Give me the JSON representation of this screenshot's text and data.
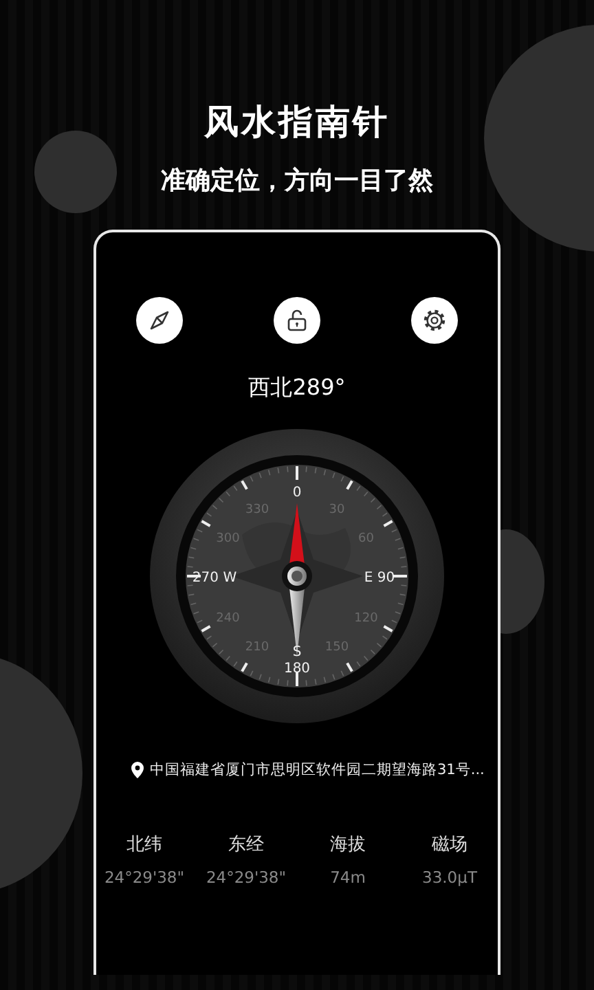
{
  "title": "风水指南针",
  "subtitle": "准确定位，方向一目了然",
  "toolbar": [
    {
      "kind": "compass"
    },
    {
      "kind": "lock"
    },
    {
      "kind": "settings"
    }
  ],
  "heading": "西北289°",
  "dial_labels": [
    "0",
    "330",
    "30",
    "300",
    "60",
    "270 W",
    "E 90",
    "240",
    "120",
    "210",
    "150",
    "180"
  ],
  "south_mark": "S",
  "address": "中国福建省厦门市思明区软件园二期望海路31号...",
  "stats": [
    {
      "label": "北纬",
      "value": "24°29'38\""
    },
    {
      "label": "东经",
      "value": "24°29'38\""
    },
    {
      "label": "海拔",
      "value": "74m"
    },
    {
      "label": "磁场",
      "value": "33.0μT"
    }
  ]
}
